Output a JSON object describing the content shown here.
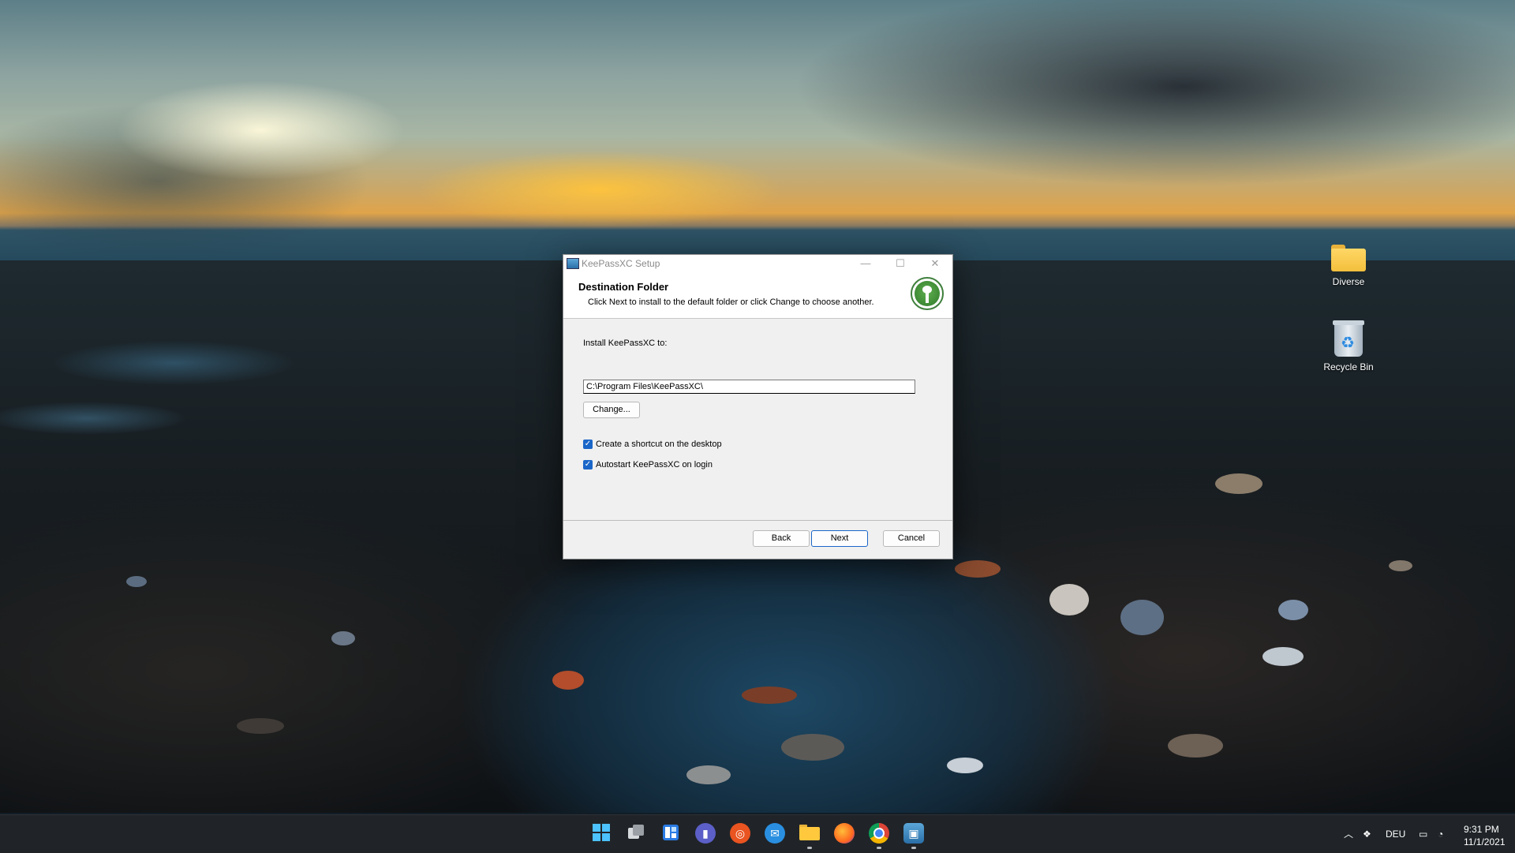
{
  "desktop": {
    "icons": [
      {
        "label": "Diverse",
        "icon": "folder-icon"
      },
      {
        "label": "Recycle Bin",
        "icon": "recycle-bin-icon"
      }
    ]
  },
  "dialog": {
    "title": "KeePassXC Setup",
    "heading": "Destination Folder",
    "subheading": "Click Next to install to the default folder or click Change to choose another.",
    "install_label": "Install KeePassXC to:",
    "install_path": "C:\\Program Files\\KeePassXC\\",
    "change_label": "Change...",
    "checkboxes": [
      {
        "label": "Create a shortcut on the desktop",
        "checked": true
      },
      {
        "label": "Autostart KeePassXC on login",
        "checked": true
      }
    ],
    "back_label": "Back",
    "next_label": "Next",
    "cancel_label": "Cancel",
    "title_buttons": {
      "minimize": "—",
      "maximize": "☐",
      "close": "✕"
    }
  },
  "taskbar": {
    "apps": [
      {
        "name": "start-button",
        "icon": "windows-icon"
      },
      {
        "name": "task-view",
        "icon": "task-view-icon"
      },
      {
        "name": "widgets",
        "icon": "widgets-icon"
      },
      {
        "name": "teams-chat",
        "icon": "chat-icon"
      },
      {
        "name": "ubuntu",
        "icon": "ubuntu-icon"
      },
      {
        "name": "app-blue",
        "icon": "app-icon"
      },
      {
        "name": "file-explorer",
        "icon": "folder-icon"
      },
      {
        "name": "firefox",
        "icon": "firefox-icon"
      },
      {
        "name": "chrome",
        "icon": "chrome-icon"
      },
      {
        "name": "keepassxc-setup",
        "icon": "installer-icon"
      }
    ],
    "tray": {
      "language": "DEU",
      "time": "9:31 PM",
      "date": "11/1/2021"
    }
  },
  "colors": {
    "accent": "#1a66c8",
    "taskbar": "#202428",
    "dialog_bg": "#f0f0f0"
  }
}
